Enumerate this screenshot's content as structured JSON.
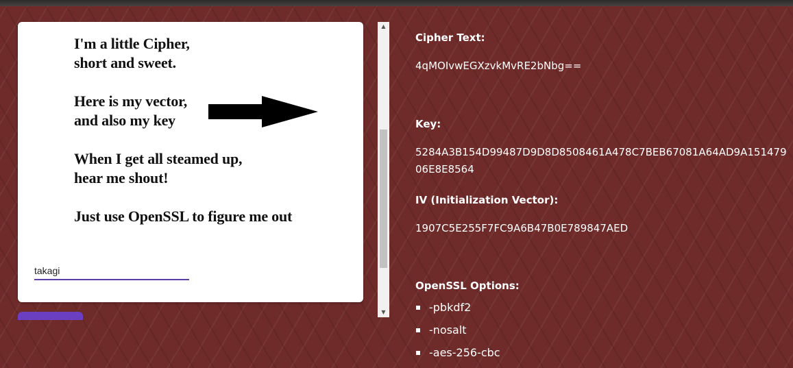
{
  "poem": {
    "lines": [
      "I'm a little Cipher,",
      "short and sweet.",
      "",
      "Here is my vector,",
      "and also my key",
      "",
      "When I get all steamed up,",
      "hear me shout!",
      "",
      "Just use OpenSSL to figure me out"
    ]
  },
  "answer": {
    "value": "takagi"
  },
  "panel": {
    "cipher_label": "Cipher Text:",
    "cipher_value": "4qMOIvwEGXzvkMvRE2bNbg==",
    "key_label": "Key:",
    "key_value": "5284A3B154D99487D9D8D8508461A478C7BEB67081A64AD9A15147906E8E8564",
    "iv_label": "IV (Initialization Vector):",
    "iv_value": "1907C5E255F7FC9A6B47B0E789847AED",
    "options_label": "OpenSSL Options:",
    "options": [
      "-pbkdf2",
      "-nosalt",
      "-aes-256-cbc"
    ]
  },
  "icons": {
    "arrow": "right-arrow-icon",
    "scroll_up": "▲",
    "scroll_down": "▼"
  },
  "colors": {
    "background": "#6e2b29",
    "accent": "#6a3fc1"
  }
}
